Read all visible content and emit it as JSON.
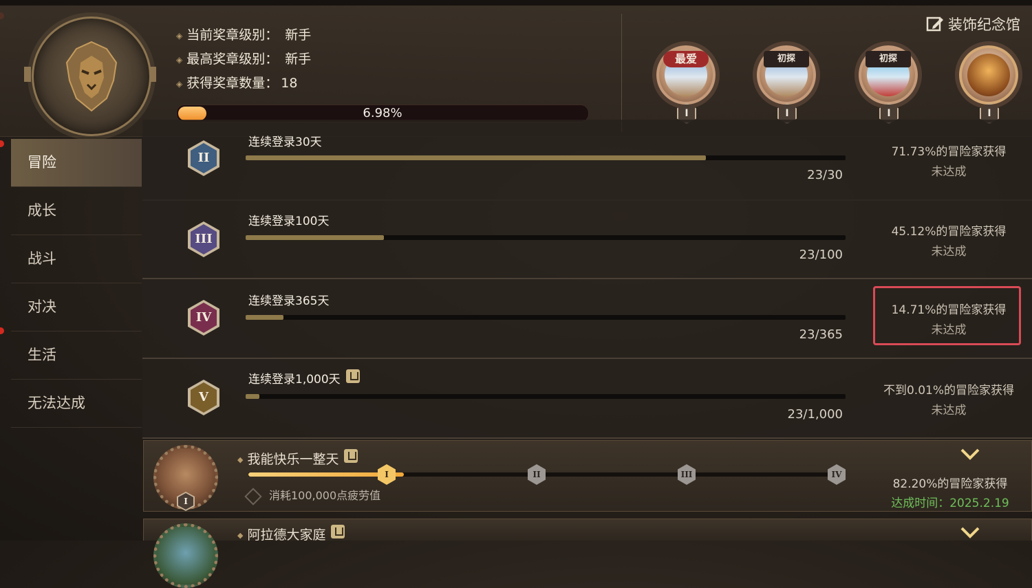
{
  "header": {
    "current_level_label": "当前奖章级别：",
    "current_level_value": "新手",
    "highest_level_label": "最高奖章级别：",
    "highest_level_value": "新手",
    "medal_count_label": "获得奖章数量：",
    "medal_count_value": "18",
    "progress_text": "6.98%",
    "progress_fraction": 0.0698,
    "decorate_link": "装饰纪念馆",
    "medals": [
      {
        "tag": "最爱",
        "level": "I"
      },
      {
        "tag": "初探",
        "level": "I"
      },
      {
        "tag": "初探",
        "level": "I"
      },
      {
        "tag": "",
        "level": "I"
      }
    ]
  },
  "sidebar": {
    "items": [
      {
        "label": "冒险",
        "active": true
      },
      {
        "label": "成长"
      },
      {
        "label": "战斗"
      },
      {
        "label": "对决"
      },
      {
        "label": "生活"
      },
      {
        "label": "无法达成"
      }
    ]
  },
  "achievements": [
    {
      "tier": "II",
      "title": "连续登录30天",
      "count": "23/30",
      "progress": 0.7667,
      "percent": "71.73%的冒险家获得",
      "status": "未达成"
    },
    {
      "tier": "III",
      "title": "连续登录100天",
      "count": "23/100",
      "progress": 0.23,
      "percent": "45.12%的冒险家获得",
      "status": "未达成"
    },
    {
      "tier": "IV",
      "title": "连续登录365天",
      "count": "23/365",
      "progress": 0.063,
      "percent": "14.71%的冒险家获得",
      "status": "未达成"
    },
    {
      "tier": "V",
      "title": "连续登录1,000天",
      "count": "23/1,000",
      "progress": 0.023,
      "percent": "不到0.01%的冒险家获得",
      "status": "未达成"
    }
  ],
  "groups": [
    {
      "title": "我能快乐一整天",
      "subtitle": "消耗100,000点疲劳值",
      "percent": "82.20%的冒险家获得",
      "date": "达成时间：2025.2.19",
      "level": "I",
      "marks": [
        "I",
        "II",
        "III",
        "IV"
      ]
    },
    {
      "title": "阿拉德大家庭"
    }
  ],
  "colors": {
    "accent_orange": "#f0902c",
    "highlight_red": "#d94a56",
    "achieved_green": "#6fbf5a"
  }
}
